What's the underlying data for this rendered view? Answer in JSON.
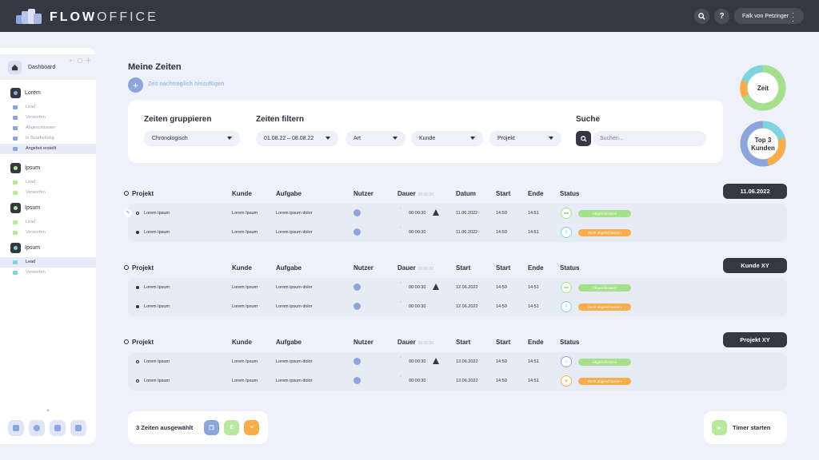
{
  "app": {
    "brand_bold": "FLOW",
    "brand_light": "OFFICE",
    "search_icon": "search-icon",
    "help_label": "?",
    "user_name": "Falk von Petzinger"
  },
  "sidebar": {
    "dashboard_label": "Dashboard",
    "groups": [
      {
        "label": "Lorem",
        "icon": "folder-icon",
        "accent": "#8ea5dc",
        "items": [
          {
            "label": "Lead"
          },
          {
            "label": "Verworfen"
          },
          {
            "label": "Abgeschlossen"
          },
          {
            "label": "In Bearbeitung"
          },
          {
            "label": "Angebot erstellt"
          }
        ]
      },
      {
        "label": "Ipsum",
        "icon": "crown-icon",
        "accent": "#b8e89c",
        "items": [
          {
            "label": "Lead"
          },
          {
            "label": "Verworfen"
          }
        ]
      },
      {
        "label": "Ipsum",
        "icon": "circle-icon",
        "accent": "#b8e89c",
        "items": [
          {
            "label": "Lead"
          },
          {
            "label": "Verworfen"
          }
        ]
      },
      {
        "label": "Ipsum",
        "icon": "clock-icon",
        "accent": "#7fd4de",
        "items": [
          {
            "label": "Lead"
          },
          {
            "label": "Verworfen"
          }
        ]
      }
    ]
  },
  "page": {
    "title": "Meine Zeiten",
    "add_label": "Zeit nachträglich hinzufügen"
  },
  "filters": {
    "group_heading": "Zeiten gruppieren",
    "group_value": "Chronologisch",
    "filter_heading": "Zeiten filtern",
    "date_range": "01.08.22 – 08.08.22",
    "type_label": "Art",
    "customer_label": "Kunde",
    "project_label": "Projekt",
    "search_heading": "Suche",
    "search_placeholder": "Suchen..."
  },
  "widgets": {
    "time_label": "Zeit",
    "top_label_1": "Top 3",
    "top_label_2": "Kunden",
    "colors": [
      "#f8ad4a",
      "#a6e08a",
      "#7fd4de",
      "#8ea5dc"
    ]
  },
  "tables": [
    {
      "tag": "11.06.2022",
      "headers": [
        "Projekt",
        "Kunde",
        "Aufgabe",
        "Nutzer",
        "Dauer",
        "Datum",
        "Start",
        "Ende",
        "Status"
      ],
      "dauer_sub": "00:00:30",
      "rows": [
        {
          "project": "Lorem Ipsum",
          "customer": "Lorem Ipsum",
          "task": "Lorem ipsum dolor",
          "duration": "00:00:30",
          "date": "11.06.2022",
          "start": "14:50",
          "end": "14:51",
          "status": "Abgeschlossen",
          "status_color": "green",
          "status_icon": "folder-icon",
          "icon_color": "#a6e08a",
          "ring": true,
          "edit": true,
          "warn": true
        },
        {
          "project": "Lorem Ipsum",
          "customer": "Lorem Ipsum",
          "task": "Lorem ipsum dolor",
          "duration": "00:00:30",
          "date": "11.06.2022",
          "start": "14:50",
          "end": "14:51",
          "status": "Nicht abgeschlossen",
          "status_color": "orange",
          "status_icon": "list-icon",
          "icon_color": "#7fd4de",
          "ring": false,
          "edit": false,
          "warn": false
        }
      ]
    },
    {
      "tag": "Kunde XY",
      "headers": [
        "Projekt",
        "Kunde",
        "Aufgabe",
        "Nutzer",
        "Dauer",
        "Start",
        "Start",
        "Ende",
        "Status"
      ],
      "dauer_sub": "00:00:30",
      "rows": [
        {
          "project": "Lorem Ipsum",
          "customer": "Lorem Ipsum",
          "task": "Lorem ipsum dolor",
          "duration": "00:00:30",
          "date": "12.06.2022",
          "start": "14:50",
          "end": "14:51",
          "status": "Abgeschlossen",
          "status_color": "green",
          "status_icon": "folder-icon",
          "icon_color": "#a6e08a",
          "ring": false,
          "edit": false,
          "warn": true
        },
        {
          "project": "Lorem Ipsum",
          "customer": "Lorem Ipsum",
          "task": "Lorem ipsum dolor",
          "duration": "00:00:30",
          "date": "12.06.2022",
          "start": "14:50",
          "end": "14:51",
          "status": "Nicht abgeschlossen",
          "status_color": "orange",
          "status_icon": "list-icon",
          "icon_color": "#7fd4de",
          "ring": false,
          "edit": false,
          "warn": false
        }
      ]
    },
    {
      "tag": "Projekt XY",
      "headers": [
        "Projekt",
        "Kunde",
        "Aufgabe",
        "Nutzer",
        "Dauer",
        "Start",
        "Start",
        "Ende",
        "Status"
      ],
      "dauer_sub": "00:00:30",
      "rows": [
        {
          "project": "Lorem Ipsum",
          "customer": "Lorem Ipsum",
          "task": "Lorem ipsum dolor",
          "duration": "00:00:30",
          "date": "13.06.2022",
          "start": "14:50",
          "end": "14:51",
          "status": "Abgeschlossen",
          "status_color": "green",
          "status_icon": "home-icon",
          "icon_color": "#8ea5dc",
          "ring": true,
          "edit": false,
          "warn": true
        },
        {
          "project": "Lorem Ipsum",
          "customer": "Lorem Ipsum",
          "task": "Lorem ipsum dolor",
          "duration": "00:00:30",
          "date": "13.06.2022",
          "start": "14:50",
          "end": "14:51",
          "status": "Nicht abgeschlossen",
          "status_color": "orange",
          "status_icon": "close-icon",
          "icon_color": "#f8ad4a",
          "ring": true,
          "edit": false,
          "warn": false
        }
      ]
    }
  ],
  "footer": {
    "selected_label": "3 Zeiten ausgewählt",
    "timer_label": "Timer starten"
  }
}
